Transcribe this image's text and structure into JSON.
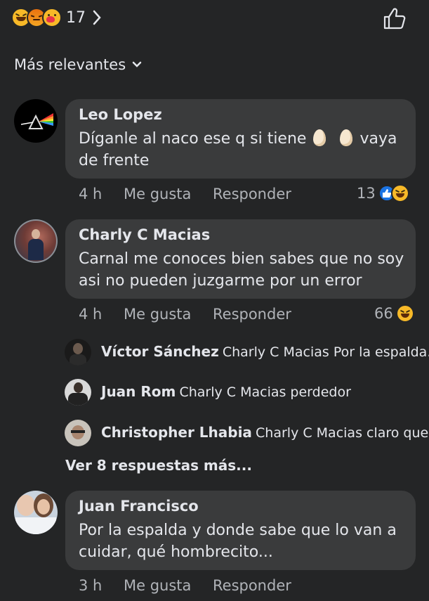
{
  "header": {
    "reaction_count": "17",
    "filter_label": "Más relevantes"
  },
  "comments": [
    {
      "name": "Leo Lopez",
      "text_before": "Díganle al naco ese q si tiene",
      "text_after": "vaya",
      "text_line2": "de frente",
      "time": "4 h",
      "like": "Me gusta",
      "reply": "Responder",
      "reactions": "13"
    },
    {
      "name": "Charly C Macias",
      "text_line1": "Carnal me conoces bien sabes que no soy",
      "text_line2": "asi no pueden juzgarme por un error",
      "time": "4 h",
      "like": "Me gusta",
      "reply": "Responder",
      "reactions": "66"
    },
    {
      "name": "Juan Francisco",
      "text_line1": "Por la espalda y donde sabe que lo van a",
      "text_line2": "cuidar, qué hombrecito...",
      "time": "3 h",
      "like": "Me gusta",
      "reply": "Responder"
    }
  ],
  "replies": [
    {
      "name": "Víctor Sánchez",
      "text": "Charly C Macias Por la espalda..."
    },
    {
      "name": "Juan Rom",
      "text": "Charly C Macias perdedor"
    },
    {
      "name": "Christopher Lhabia",
      "text": "Charly C Macias  claro que..."
    }
  ],
  "more_replies": "Ver 8 respuestas más..."
}
